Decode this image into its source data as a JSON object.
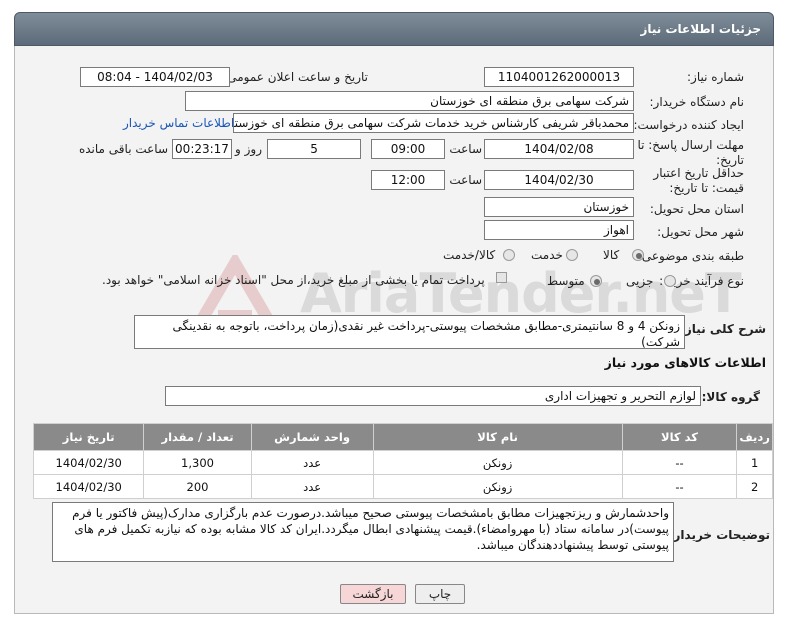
{
  "panel": {
    "title": "جزئیات اطلاعات نیاز"
  },
  "form": {
    "need_number_label": "شماره نیاز:",
    "need_number": "1104001262000013",
    "announce_label": "تاریخ و ساعت اعلان عمومی:",
    "announce_value": "1404/02/03 - 08:04",
    "buyer_label": "نام دستگاه خریدار:",
    "buyer_value": "شرکت سهامی برق منطقه ای خوزستان",
    "creator_label": "ایجاد کننده درخواست:",
    "creator_value": "محمدباقر شریفی کارشناس خرید خدمات شرکت سهامی برق منطقه ای خوزستان",
    "contact_link": "اطلاعات تماس خریدار",
    "reply_deadline_label": "مهلت ارسال پاسخ: تا تاریخ:",
    "reply_date": "1404/02/08",
    "time_label": "ساعت",
    "reply_time": "09:00",
    "days_value": "5",
    "days_label": "روز و",
    "remaining_time": "00:23:17",
    "remaining_label": "ساعت باقی مانده",
    "price_validity_label": "حداقل تاریخ اعتبار قیمت: تا تاریخ:",
    "price_date": "1404/02/30",
    "price_time": "12:00",
    "province_label": "استان محل تحویل:",
    "province_value": "خوزستان",
    "city_label": "شهر محل تحویل:",
    "city_value": "اهواز",
    "category_label": "طبقه بندی موضوعی:",
    "category_options": [
      "کالا",
      "خدمت",
      "کالا/خدمت"
    ],
    "category_selected": "کالا",
    "process_label": "نوع فرآیند خرید :",
    "process_options": [
      "جزیی",
      "متوسط"
    ],
    "process_selected": "متوسط",
    "payment_note": "پرداخت تمام یا بخشی از مبلغ خرید،از محل \"اسناد خزانه اسلامی\" خواهد بود."
  },
  "description": {
    "label": "شرح کلی نیاز:",
    "text": "زونکن 4 و 8 سانتیمتری-مطابق مشخصات پیوستی-پرداخت غیر نقدی(زمان پرداخت، باتوجه به نقدینگی شرکت)"
  },
  "goods": {
    "section_title": "اطلاعات کالاهای مورد نیاز",
    "group_label": "گروه کالا:",
    "group_value": "لوازم التحریر و تجهیزات اداری",
    "columns": [
      "ردیف",
      "کد کالا",
      "نام کالا",
      "واحد شمارش",
      "تعداد / مقدار",
      "تاریخ نیاز"
    ],
    "rows": [
      {
        "row": "1",
        "code": "--",
        "name": "زونکن",
        "unit": "عدد",
        "qty": "1,300",
        "date": "1404/02/30"
      },
      {
        "row": "2",
        "code": "--",
        "name": "زونکن",
        "unit": "عدد",
        "qty": "200",
        "date": "1404/02/30"
      }
    ]
  },
  "buyer_notes": {
    "label": "توضیحات خریدار:",
    "text": "واحدشمارش و ریزتجهیزات مطابق بامشخصات پیوستی صحیح میباشد.درصورت عدم بارگزاری مدارک(پیش فاکتور یا فرم پیوست)در سامانه ستاد (با مهروامضاء).قیمت پیشنهادی ابطال میگردد.ایران کد کالا مشابه بوده که نیازبه تکمیل فرم های پیوستی توسط پیشنهاددهندگان میباشد."
  },
  "buttons": {
    "print": "چاپ",
    "back": "بازگشت"
  },
  "watermark": {
    "text": "AriaTender.neT"
  },
  "colors": {
    "header": "#6f7c8a",
    "link": "#1a56b8",
    "back_button": "#f6d6d6",
    "print_button": "#eeeeee"
  }
}
